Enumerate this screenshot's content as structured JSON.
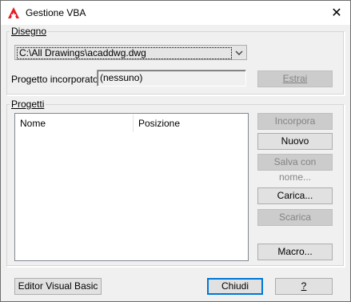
{
  "window": {
    "title": "Gestione VBA",
    "close_glyph": "✕",
    "icon": "autocad-a-icon",
    "accent_color": "#e51d25"
  },
  "disegno": {
    "group_label": "Disegno",
    "drawing_select_value": "C:\\All Drawings\\acaddwg.dwg",
    "embedded_project_label": "Progetto incorporato:",
    "embedded_project_value": "(nessuno)",
    "extract_button": "Estrai"
  },
  "progetti": {
    "group_label": "Progetti",
    "columns": [
      "Nome",
      "Posizione"
    ],
    "rows": [],
    "buttons": {
      "embed": "Incorpora",
      "new": "Nuovo",
      "save_as": "Salva con nome...",
      "load": "Carica...",
      "unload": "Scarica",
      "macros": "Macro..."
    }
  },
  "footer": {
    "vb_editor_button": "Editor Visual Basic",
    "close_button": "Chiudi",
    "help_button": "?"
  }
}
